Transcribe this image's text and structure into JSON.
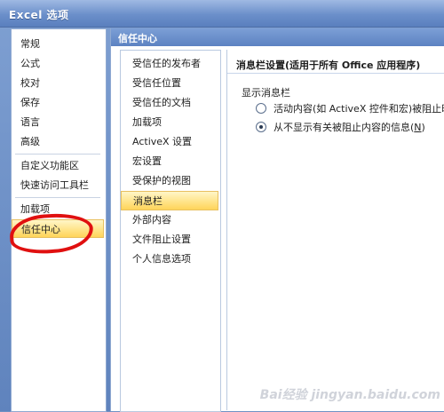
{
  "window": {
    "title": "Excel 选项"
  },
  "left_nav": {
    "items": [
      {
        "label": "常规"
      },
      {
        "label": "公式"
      },
      {
        "label": "校对"
      },
      {
        "label": "保存"
      },
      {
        "label": "语言"
      },
      {
        "label": "高级"
      },
      {
        "label": "自定义功能区"
      },
      {
        "label": "快速访问工具栏"
      },
      {
        "label": "加载项"
      },
      {
        "label": "信任中心",
        "selected": true
      }
    ]
  },
  "section": {
    "title": "信任中心"
  },
  "mid_nav": {
    "items": [
      {
        "label": "受信任的发布者"
      },
      {
        "label": "受信任位置"
      },
      {
        "label": "受信任的文档"
      },
      {
        "label": "加载项"
      },
      {
        "label": "ActiveX 设置"
      },
      {
        "label": "宏设置"
      },
      {
        "label": "受保护的视图"
      },
      {
        "label": "消息栏",
        "selected": true
      },
      {
        "label": "外部内容"
      },
      {
        "label": "文件阻止设置"
      },
      {
        "label": "个人信息选项"
      }
    ]
  },
  "content": {
    "header": "消息栏设置(适用于所有 Office 应用程序)",
    "group_label": "显示消息栏",
    "options": [
      {
        "label": "活动内容(如 ActiveX 控件和宏)被阻止时在",
        "checked": false
      },
      {
        "label_prefix": "从不显示有关被阻止内容的信息(",
        "label_key": "N",
        "label_suffix": ")",
        "checked": true
      }
    ]
  },
  "watermark": {
    "text": "Bai经验 jingyan.baidu.com"
  },
  "colors": {
    "annotation": "#e01010",
    "selection": "#ffe48a",
    "header": "#5c82c2"
  }
}
